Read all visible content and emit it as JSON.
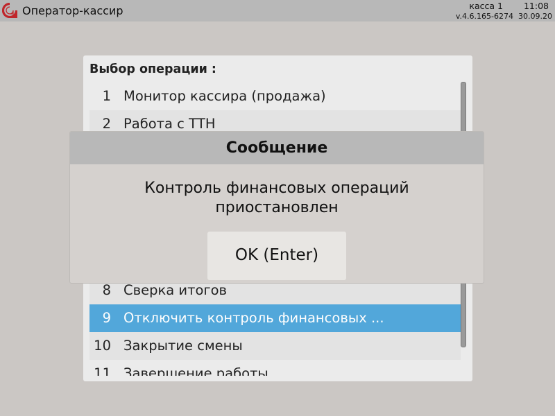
{
  "header": {
    "app_title": "Оператор-кассир",
    "register": "касса 1",
    "time": "11:08",
    "version": "v.4.6.165-6274",
    "date": "30.09.20"
  },
  "colors": {
    "logo": "#c0262b",
    "selected_row": "#52a7da"
  },
  "icons": {
    "logo": "brand-logo-icon"
  },
  "menu": {
    "title": "Выбор операции :",
    "items": [
      {
        "num": "1",
        "label": "Монитор кассира (продажа)"
      },
      {
        "num": "2",
        "label": "Работа с ТТН"
      },
      {
        "num": "8",
        "label": "Сверка итогов"
      },
      {
        "num": "9",
        "label": "Отключить контроль финансовых ...",
        "selected": true
      },
      {
        "num": "10",
        "label": "Закрытие смены"
      },
      {
        "num": "11",
        "label": "Завершение работы"
      }
    ]
  },
  "dialog": {
    "title": "Сообщение",
    "message_line1": "Контроль финансовых операций",
    "message_line2": "приостановлен",
    "ok_label": "OK (Enter)"
  }
}
